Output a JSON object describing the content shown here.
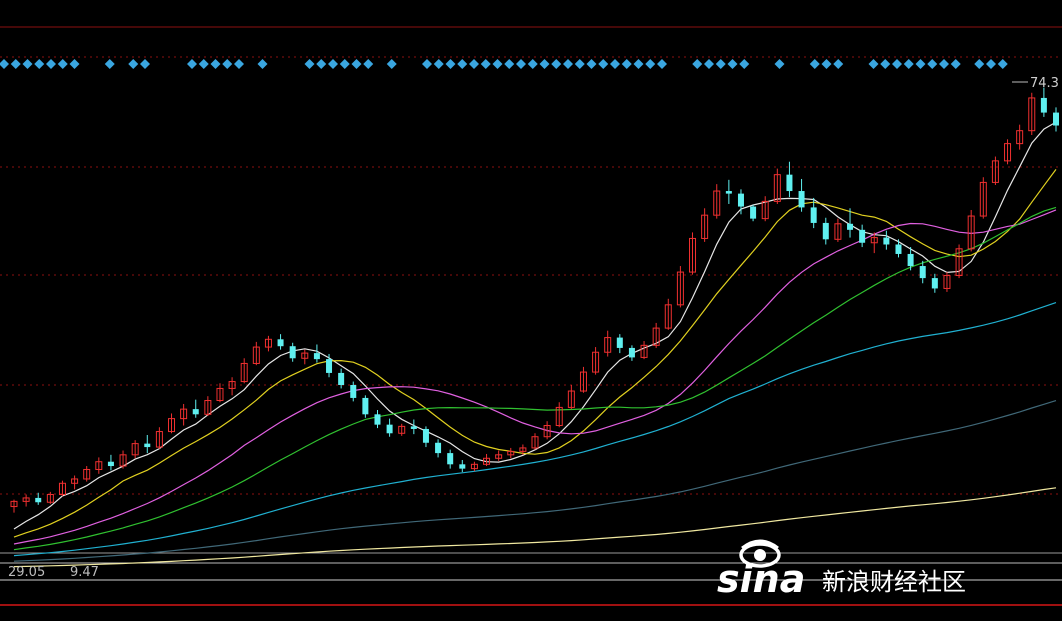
{
  "chart_data": {
    "type": "candlestick",
    "grid": "dotted horizontal, dark red",
    "price_range": [
      26,
      84
    ],
    "annotations": {
      "high_marker_label": "74.3",
      "low_marker_label": "29.05",
      "low_marker_label_2": "9.47"
    },
    "signal_row": {
      "color": "#3aa6e0",
      "marks": [
        1,
        1,
        1,
        1,
        1,
        1,
        1,
        0,
        0,
        1,
        0,
        1,
        1,
        0,
        0,
        0,
        1,
        1,
        1,
        1,
        1,
        0,
        1,
        0,
        0,
        0,
        1,
        1,
        1,
        1,
        1,
        1,
        0,
        1,
        0,
        0,
        1,
        1,
        1,
        1,
        1,
        1,
        1,
        1,
        1,
        1,
        1,
        1,
        1,
        1,
        1,
        1,
        1,
        1,
        1,
        1,
        1,
        0,
        0,
        1,
        1,
        1,
        1,
        1,
        0,
        0,
        1,
        0,
        0,
        1,
        1,
        1,
        0,
        0,
        1,
        1,
        1,
        1,
        1,
        1,
        1,
        1,
        0,
        1,
        1,
        1
      ]
    },
    "candles": [
      [
        32.2,
        33.0,
        31.5,
        32.8
      ],
      [
        32.8,
        33.6,
        32.2,
        33.2
      ],
      [
        33.2,
        33.8,
        32.4,
        32.7
      ],
      [
        32.7,
        33.9,
        32.5,
        33.6
      ],
      [
        33.6,
        35.2,
        33.4,
        34.9
      ],
      [
        34.9,
        35.8,
        34.2,
        35.4
      ],
      [
        35.4,
        36.9,
        35.1,
        36.5
      ],
      [
        36.5,
        37.9,
        36.0,
        37.4
      ],
      [
        37.4,
        38.2,
        36.4,
        36.9
      ],
      [
        36.9,
        38.7,
        36.6,
        38.2
      ],
      [
        38.2,
        39.9,
        37.8,
        39.5
      ],
      [
        39.5,
        40.5,
        38.4,
        39.1
      ],
      [
        39.1,
        41.4,
        38.9,
        40.9
      ],
      [
        40.9,
        43.0,
        40.7,
        42.4
      ],
      [
        42.4,
        44.1,
        41.6,
        43.5
      ],
      [
        43.5,
        44.6,
        42.5,
        42.9
      ],
      [
        42.9,
        45.0,
        42.7,
        44.5
      ],
      [
        44.5,
        46.5,
        44.3,
        45.9
      ],
      [
        45.9,
        47.2,
        45.1,
        46.7
      ],
      [
        46.7,
        49.4,
        46.5,
        48.8
      ],
      [
        48.8,
        51.3,
        48.6,
        50.7
      ],
      [
        50.7,
        52.0,
        50.2,
        51.6
      ],
      [
        51.6,
        52.2,
        50.4,
        50.8
      ],
      [
        50.8,
        51.2,
        49.0,
        49.4
      ],
      [
        49.4,
        50.4,
        48.7,
        50.0
      ],
      [
        50.0,
        51.0,
        48.9,
        49.3
      ],
      [
        49.3,
        49.9,
        47.2,
        47.7
      ],
      [
        47.7,
        48.2,
        45.9,
        46.3
      ],
      [
        46.3,
        46.7,
        44.4,
        44.8
      ],
      [
        44.8,
        45.1,
        42.5,
        42.9
      ],
      [
        42.9,
        43.4,
        41.3,
        41.7
      ],
      [
        41.7,
        42.4,
        40.3,
        40.7
      ],
      [
        40.7,
        41.8,
        40.4,
        41.5
      ],
      [
        41.5,
        42.3,
        40.6,
        41.2
      ],
      [
        41.2,
        41.5,
        39.1,
        39.6
      ],
      [
        39.6,
        40.0,
        37.9,
        38.4
      ],
      [
        38.4,
        38.8,
        36.6,
        37.1
      ],
      [
        37.1,
        37.6,
        36.2,
        36.6
      ],
      [
        36.6,
        37.4,
        36.3,
        37.1
      ],
      [
        37.1,
        38.3,
        36.9,
        37.8
      ],
      [
        37.8,
        38.7,
        37.5,
        38.2
      ],
      [
        38.2,
        39.0,
        37.8,
        38.6
      ],
      [
        38.6,
        39.4,
        38.2,
        39.0
      ],
      [
        39.0,
        40.7,
        38.8,
        40.3
      ],
      [
        40.3,
        42.1,
        40.0,
        41.6
      ],
      [
        41.6,
        44.3,
        41.4,
        43.7
      ],
      [
        43.7,
        46.3,
        43.5,
        45.6
      ],
      [
        45.6,
        48.4,
        45.4,
        47.8
      ],
      [
        47.8,
        50.7,
        47.5,
        50.1
      ],
      [
        50.1,
        52.6,
        49.6,
        51.8
      ],
      [
        51.8,
        52.2,
        50.0,
        50.6
      ],
      [
        50.6,
        50.9,
        49.1,
        49.5
      ],
      [
        49.5,
        51.4,
        49.3,
        50.9
      ],
      [
        50.9,
        53.5,
        50.6,
        52.9
      ],
      [
        52.9,
        56.3,
        52.7,
        55.6
      ],
      [
        55.6,
        60.1,
        55.3,
        59.4
      ],
      [
        59.4,
        64.0,
        59.1,
        63.3
      ],
      [
        63.3,
        66.8,
        62.9,
        66.0
      ],
      [
        66.0,
        69.6,
        65.6,
        68.8
      ],
      [
        68.8,
        70.1,
        67.3,
        68.5
      ],
      [
        68.5,
        69.0,
        66.1,
        67.0
      ],
      [
        67.0,
        67.2,
        65.3,
        65.6
      ],
      [
        65.6,
        68.2,
        65.3,
        67.6
      ],
      [
        67.6,
        71.4,
        67.3,
        70.7
      ],
      [
        70.7,
        72.2,
        68.1,
        68.8
      ],
      [
        68.8,
        70.2,
        66.4,
        66.9
      ],
      [
        66.9,
        68.0,
        64.5,
        65.1
      ],
      [
        65.1,
        65.7,
        62.6,
        63.2
      ],
      [
        63.2,
        65.6,
        62.9,
        65.0
      ],
      [
        65.0,
        66.8,
        63.4,
        64.3
      ],
      [
        64.3,
        64.9,
        62.3,
        62.8
      ],
      [
        62.8,
        64.0,
        61.6,
        63.4
      ],
      [
        63.4,
        64.2,
        62.0,
        62.6
      ],
      [
        62.6,
        63.2,
        61.1,
        61.5
      ],
      [
        61.5,
        62.3,
        59.6,
        60.1
      ],
      [
        60.1,
        60.7,
        58.1,
        58.7
      ],
      [
        58.7,
        59.2,
        57.0,
        57.5
      ],
      [
        57.5,
        59.4,
        57.1,
        59.0
      ],
      [
        59.0,
        62.6,
        58.7,
        62.1
      ],
      [
        62.1,
        66.6,
        61.8,
        65.9
      ],
      [
        65.9,
        70.4,
        65.6,
        69.8
      ],
      [
        69.8,
        72.8,
        69.5,
        72.3
      ],
      [
        72.3,
        74.8,
        71.9,
        74.3
      ],
      [
        74.3,
        76.5,
        73.6,
        75.8
      ],
      [
        75.8,
        80.2,
        75.3,
        79.6
      ],
      [
        79.6,
        80.8,
        77.4,
        77.9
      ],
      [
        77.9,
        78.5,
        75.7,
        76.4
      ]
    ],
    "moving_averages": [
      {
        "color": "#e6e6e6",
        "period": 5
      },
      {
        "color": "#e0d020",
        "period": 10
      },
      {
        "color": "#e060e0",
        "period": 20
      },
      {
        "color": "#30c030",
        "period": 30
      },
      {
        "color": "#20b0d0",
        "period": 60
      },
      {
        "color": "#406878",
        "period": 120
      },
      {
        "color": "#f0e8a0",
        "period": 250
      }
    ],
    "up_color": "#f03030",
    "down_color": "#5ff0f0"
  },
  "watermark": {
    "logo_text": "sina",
    "caption": "新浪财经社区"
  }
}
